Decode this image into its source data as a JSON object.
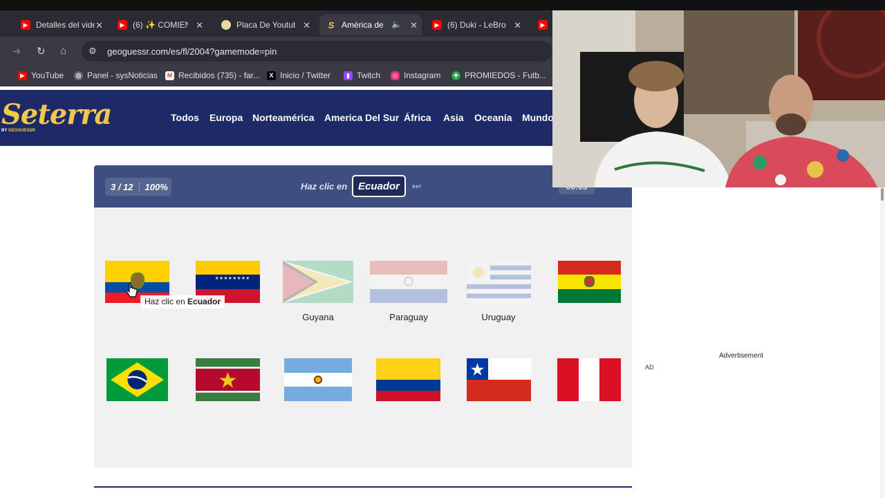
{
  "browser": {
    "tabs": [
      {
        "label": "Detalles del vide",
        "icon": "youtube-icon"
      },
      {
        "label": "(6) ✨ COMIENZ",
        "icon": "youtube-icon"
      },
      {
        "label": "Placa De Youtub",
        "icon": "generic-site-icon"
      },
      {
        "label": "América del",
        "icon": "seterra-icon",
        "active": true,
        "audio": "speaker-icon"
      },
      {
        "label": "(6) Duki - LeBron",
        "icon": "youtube-icon"
      }
    ],
    "url": "geoguessr.com/es/fl/2004?gamemode=pin",
    "bookmarks": [
      {
        "label": "YouTube",
        "icon": "youtube-icon",
        "color": "#ff0000"
      },
      {
        "label": "Panel - sysNoticias",
        "icon": "globe-icon",
        "color": "#6b6b75"
      },
      {
        "label": "Recibidos (735) - far...",
        "icon": "gmail-icon",
        "color": "#d44638"
      },
      {
        "label": "Inicio / Twitter",
        "icon": "x-icon",
        "color": "#000000"
      },
      {
        "label": "Twitch",
        "icon": "twitch-icon",
        "color": "#9146ff"
      },
      {
        "label": "Instagram",
        "icon": "instagram-icon",
        "color": "#e1306c"
      },
      {
        "label": "PROMIEDOS - Futb...",
        "icon": "promiedos-icon",
        "color": "#2e9e44"
      }
    ]
  },
  "site": {
    "logo": "Seterra",
    "logo_sub_by": "BY",
    "logo_sub_brand": "GEOGUESSR",
    "nav": [
      "Todos",
      "Europa",
      "Norteamérica",
      "America Del Sur",
      "África",
      "Asia",
      "Oceanía",
      "Mundo"
    ]
  },
  "game": {
    "progress": "3 / 12",
    "score": "100%",
    "prompt": "Haz clic en",
    "target": "Ecuador",
    "timer": "00:05",
    "tooltip_prefix": "Haz clic en",
    "tooltip_target": "Ecuador",
    "flags_row1": [
      {
        "country": "ecuador",
        "label": ""
      },
      {
        "country": "venezuela",
        "label": ""
      },
      {
        "country": "guyana",
        "label": "Guyana",
        "faded": true
      },
      {
        "country": "paraguay",
        "label": "Paraguay",
        "faded": true
      },
      {
        "country": "uruguay",
        "label": "Uruguay",
        "faded": true
      },
      {
        "country": "bolivia",
        "label": ""
      }
    ],
    "flags_row2": [
      {
        "country": "brazil"
      },
      {
        "country": "suriname"
      },
      {
        "country": "argentina"
      },
      {
        "country": "colombia"
      },
      {
        "country": "chile"
      },
      {
        "country": "peru"
      }
    ]
  },
  "ad": {
    "label": "Advertisement",
    "tag": "AD"
  },
  "colors": {
    "site_nav": "#1e2a67",
    "logo": "#f2c84b",
    "game_header": "#3e4f7f"
  }
}
